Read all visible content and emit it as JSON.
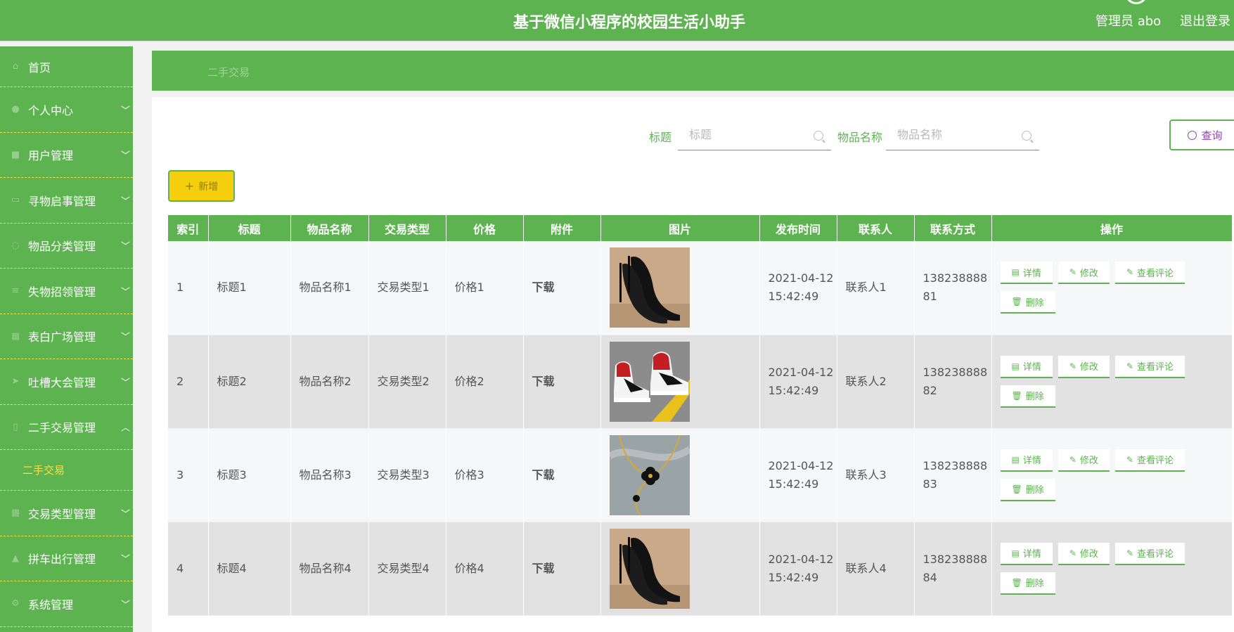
{
  "header": {
    "title": "基于微信小程序的校园生活小助手",
    "user": "管理员 abo",
    "logout": "退出登录"
  },
  "sidebar": {
    "items": [
      {
        "label": "首页",
        "icon": "home-icon",
        "chevron": ""
      },
      {
        "label": "个人中心",
        "icon": "person-icon",
        "chevron": "﹀"
      },
      {
        "label": "用户管理",
        "icon": "users-icon",
        "chevron": "﹀"
      },
      {
        "label": "寻物启事管理",
        "icon": "notice-icon",
        "chevron": "﹀"
      },
      {
        "label": "物品分类管理",
        "icon": "category-icon",
        "chevron": "﹀"
      },
      {
        "label": "失物招领管理",
        "icon": "list-icon",
        "chevron": "﹀"
      },
      {
        "label": "表白广场管理",
        "icon": "grid-icon",
        "chevron": "﹀"
      },
      {
        "label": "吐槽大会管理",
        "icon": "send-icon",
        "chevron": "﹀"
      },
      {
        "label": "二手交易管理",
        "icon": "phone-icon",
        "chevron": "︿"
      },
      {
        "label": "二手交易",
        "icon": "",
        "chevron": "",
        "sub": true
      },
      {
        "label": "交易类型管理",
        "icon": "grid-icon",
        "chevron": "﹀"
      },
      {
        "label": "拼车出行管理",
        "icon": "car-icon",
        "chevron": "﹀"
      },
      {
        "label": "系统管理",
        "icon": "settings-icon",
        "chevron": "﹀"
      }
    ]
  },
  "breadcrumb": "二手交易",
  "search": {
    "title_label": "标题",
    "title_placeholder": "标题",
    "name_label": "物品名称",
    "name_placeholder": "物品名称",
    "query_button": "查询"
  },
  "add_button": "新增",
  "table": {
    "headers": [
      "索引",
      "标题",
      "物品名称",
      "交易类型",
      "价格",
      "附件",
      "图片",
      "发布时间",
      "联系人",
      "联系方式",
      "操作"
    ],
    "rows": [
      {
        "index": "1",
        "title": "标题1",
        "name": "物品名称1",
        "type": "交易类型1",
        "price": "价格1",
        "attachment": "下载",
        "image": "high-heels",
        "time": "2021-04-12 15:42:49",
        "contact": "联系人1",
        "phone": "13823888881"
      },
      {
        "index": "2",
        "title": "标题2",
        "name": "物品名称2",
        "type": "交易类型2",
        "price": "价格2",
        "attachment": "下载",
        "image": "sneakers",
        "time": "2021-04-12 15:42:49",
        "contact": "联系人2",
        "phone": "13823888882"
      },
      {
        "index": "3",
        "title": "标题3",
        "name": "物品名称3",
        "type": "交易类型3",
        "price": "价格3",
        "attachment": "下载",
        "image": "necklace",
        "time": "2021-04-12 15:42:49",
        "contact": "联系人3",
        "phone": "13823888883"
      },
      {
        "index": "4",
        "title": "标题4",
        "name": "物品名称4",
        "type": "交易类型4",
        "price": "价格4",
        "attachment": "下载",
        "image": "high-heels",
        "time": "2021-04-12 15:42:49",
        "contact": "联系人4",
        "phone": "13823888884"
      }
    ],
    "actions": {
      "detail": "详情",
      "edit": "修改",
      "comments": "查看评论",
      "delete": "删除"
    }
  },
  "colors": {
    "primary": "#5db350",
    "accent_yellow": "#f5cf0d",
    "query_text": "#8e44ad"
  }
}
